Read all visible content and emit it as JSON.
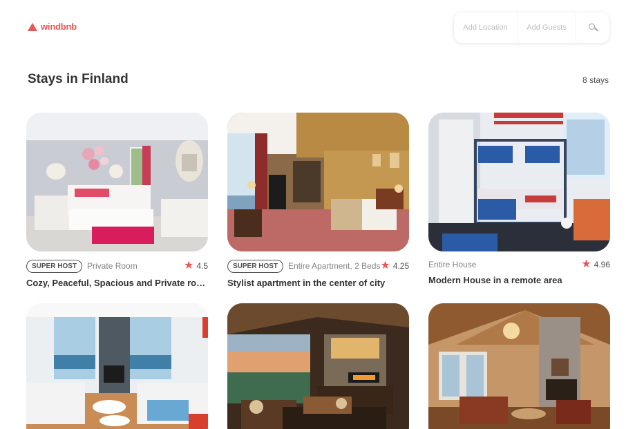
{
  "header": {
    "logo_text": "windbnb",
    "search": {
      "location_placeholder": "Add Location",
      "guests_placeholder": "Add Guests",
      "search_icon": "search-icon"
    }
  },
  "main": {
    "title": "Stays in Finland",
    "count": "8 stays"
  },
  "stays": [
    {
      "super_host": "SUPER HOST",
      "type": "Private Room",
      "rating": "4.5",
      "title": "Cozy, Peaceful, Spacious and Private room..."
    },
    {
      "super_host": "SUPER HOST",
      "type": "Entire Apartment, 2 Beds",
      "rating": "4.25",
      "title": "Stylist apartment in the center of city"
    },
    {
      "super_host": "",
      "type": "Entire House",
      "rating": "4.96",
      "title": "Modern House in a remote area"
    }
  ],
  "colors": {
    "accent": "#EB5757",
    "text": "#333333",
    "muted": "#828282"
  }
}
